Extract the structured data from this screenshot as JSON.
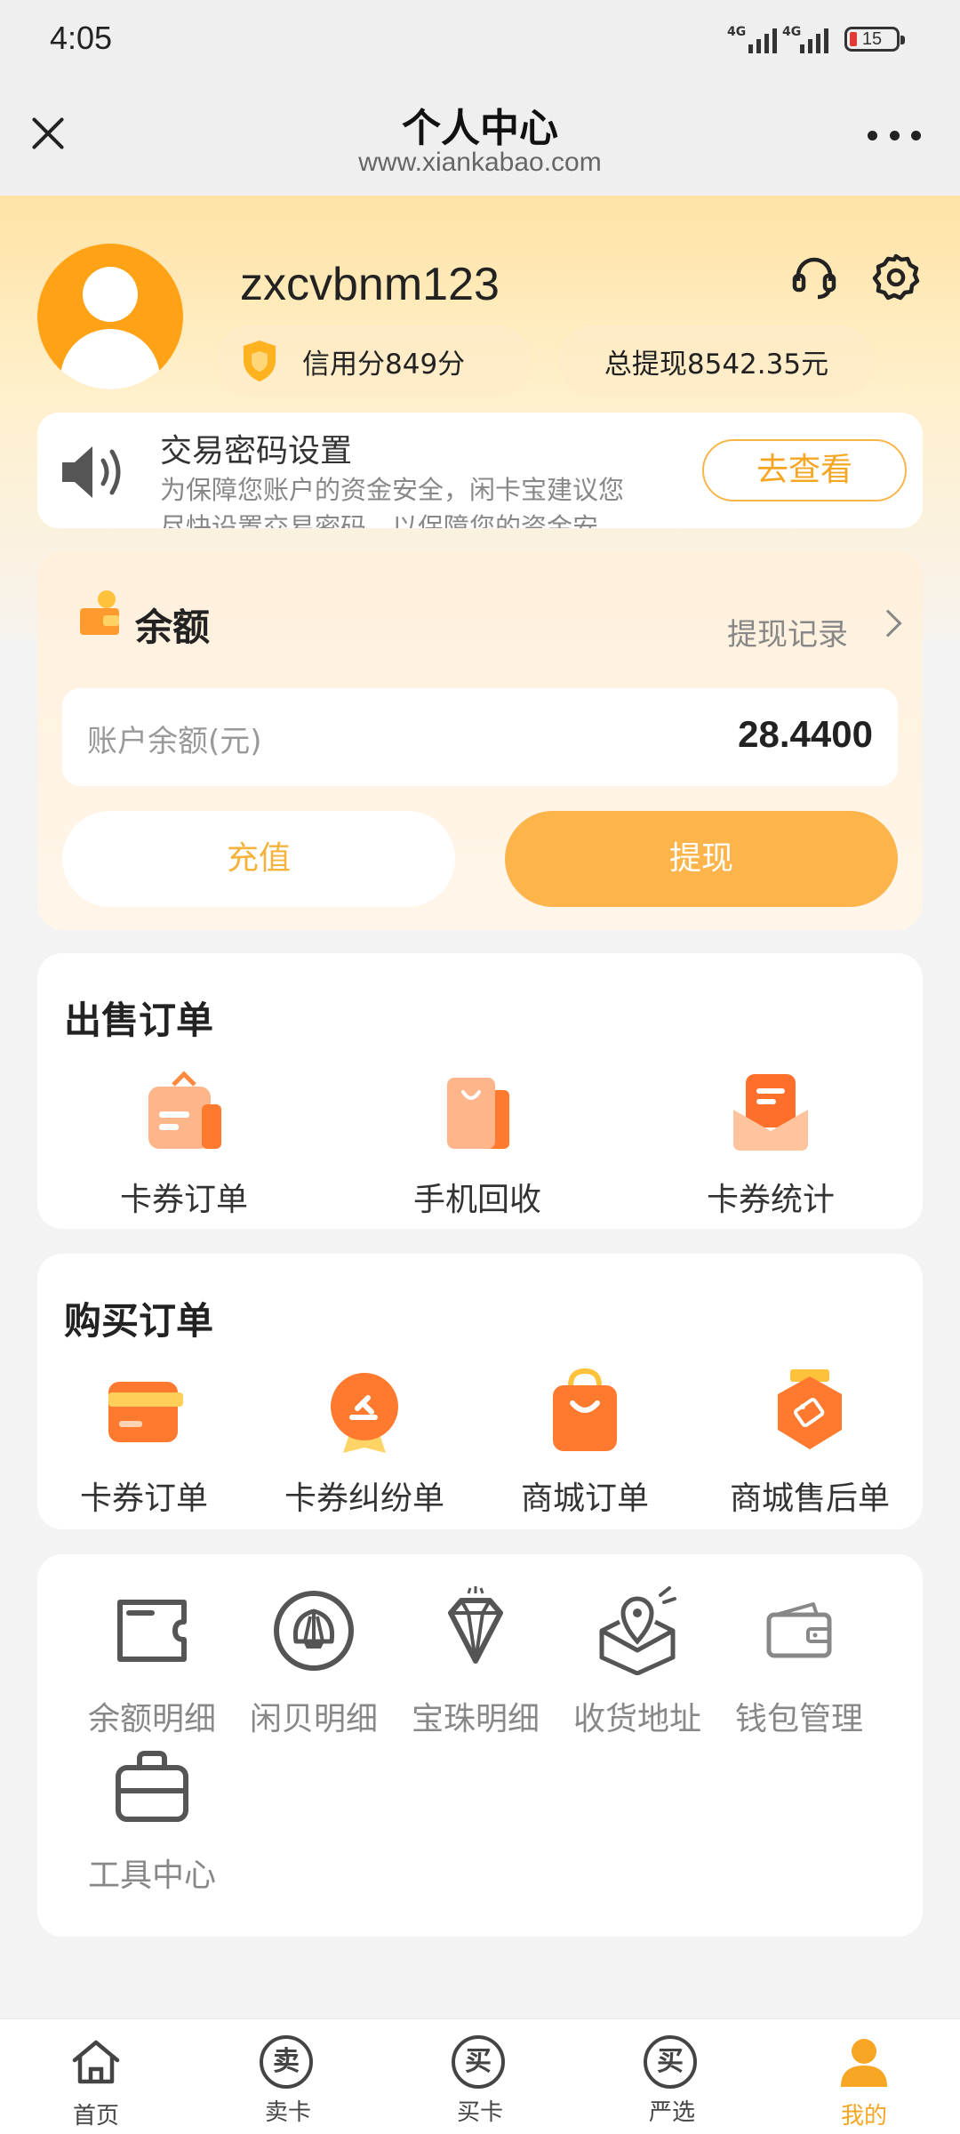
{
  "status_bar": {
    "time": "4:05",
    "network1": "4G",
    "network2": "4G",
    "battery": "15"
  },
  "nav": {
    "title": "个人中心",
    "url": "www.xiankabao.com"
  },
  "profile": {
    "username": "zxcvbnm123",
    "credit_label": "信用分849分",
    "withdraw_total_label": "总提现8542.35元"
  },
  "notice": {
    "title": "交易密码设置",
    "text": "为保障您账户的资金安全，闲卡宝建议您尽快设置交易密码，以保障您的资金安全。",
    "button": "去查看"
  },
  "balance": {
    "title": "余额",
    "records_link": "提现记录",
    "account_label": "账户余额(元)",
    "account_value": "28.4400",
    "recharge_button": "充值",
    "withdraw_button": "提现"
  },
  "sell_orders": {
    "title": "出售订单",
    "items": [
      {
        "label": "卡券订单",
        "icon": "card-order-icon"
      },
      {
        "label": "手机回收",
        "icon": "phone-recycle-icon"
      },
      {
        "label": "卡券统计",
        "icon": "card-stats-icon"
      }
    ]
  },
  "buy_orders": {
    "title": "购买订单",
    "items": [
      {
        "label": "卡券订单",
        "icon": "card-icon"
      },
      {
        "label": "卡券纠纷单",
        "icon": "dispute-icon"
      },
      {
        "label": "商城订单",
        "icon": "shop-bag-icon"
      },
      {
        "label": "商城售后单",
        "icon": "after-sale-icon"
      }
    ]
  },
  "tools": {
    "items": [
      {
        "label": "余额明细",
        "icon": "wallet-card-icon"
      },
      {
        "label": "闲贝明细",
        "icon": "shell-icon"
      },
      {
        "label": "宝珠明细",
        "icon": "diamond-icon"
      },
      {
        "label": "收货地址",
        "icon": "address-icon"
      },
      {
        "label": "钱包管理",
        "icon": "wallet-icon"
      },
      {
        "label": "工具中心",
        "icon": "toolbox-icon"
      }
    ]
  },
  "tabbar": {
    "items": [
      {
        "label": "首页",
        "icon": "home-icon"
      },
      {
        "label": "卖卡",
        "glyph": "卖"
      },
      {
        "label": "买卡",
        "glyph": "买"
      },
      {
        "label": "严选",
        "glyph": "买"
      },
      {
        "label": "我的",
        "icon": "user-icon"
      }
    ],
    "active_color": "#f6a623"
  },
  "colors": {
    "accent": "#fdb44a",
    "brand_orange": "#ffa216"
  }
}
